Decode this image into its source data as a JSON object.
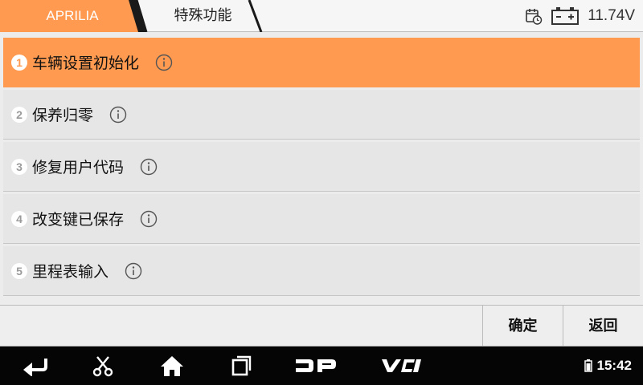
{
  "header": {
    "breadcrumb": [
      {
        "label": "APRILIA"
      },
      {
        "label": "特殊功能"
      }
    ],
    "voltage": "11.74V",
    "icons": [
      "calendar-clock-icon",
      "battery-icon"
    ]
  },
  "menu": {
    "items": [
      {
        "num": "1",
        "label": "车辆设置初始化",
        "selected": true
      },
      {
        "num": "2",
        "label": "保养归零",
        "selected": false
      },
      {
        "num": "3",
        "label": "修复用户代码",
        "selected": false
      },
      {
        "num": "4",
        "label": "改变键已保存",
        "selected": false
      },
      {
        "num": "5",
        "label": "里程表输入",
        "selected": false
      }
    ]
  },
  "actions": {
    "ok_label": "确定",
    "back_label": "返回"
  },
  "navbar": {
    "icons": [
      "back-icon",
      "scissors-icon",
      "home-icon",
      "recents-icon",
      "dp-icon",
      "vci-icon"
    ],
    "dp_text": "DP",
    "vci_text": "VCI",
    "time": "15:42"
  },
  "colors": {
    "accent": "#ff9a50",
    "tab_dark": "#1a1a1a",
    "row_bg": "#e6e6e6",
    "nav_bg": "#050505"
  }
}
